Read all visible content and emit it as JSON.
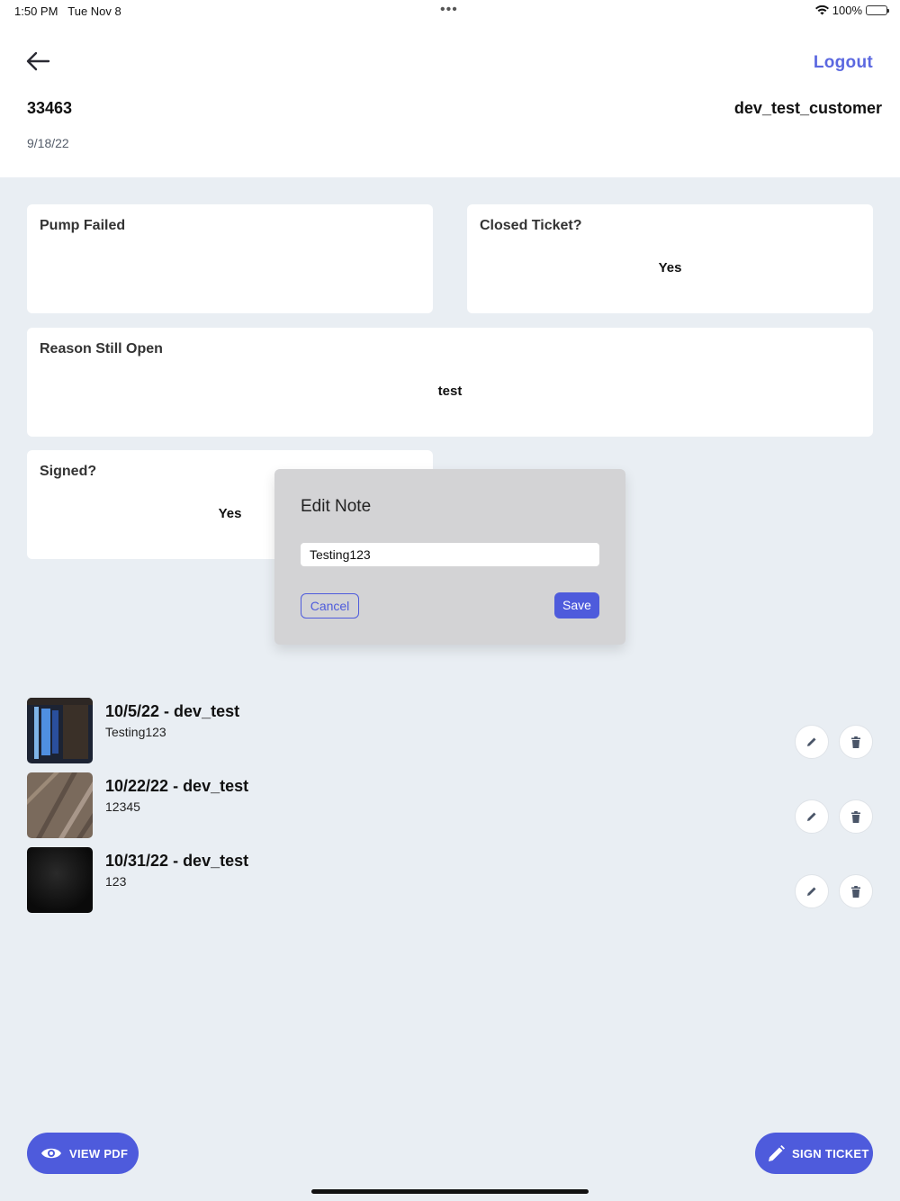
{
  "status_bar": {
    "time": "1:50 PM",
    "date": "Tue Nov 8",
    "battery": "100%"
  },
  "header": {
    "logout_label": "Logout",
    "ticket_id": "33463",
    "customer": "dev_test_customer",
    "date": "9/18/22"
  },
  "cards": {
    "pump_failed": {
      "label": "Pump Failed",
      "value": ""
    },
    "closed_ticket": {
      "label": "Closed Ticket?",
      "value": "Yes"
    },
    "reason_open": {
      "label": "Reason Still Open",
      "value": "test"
    },
    "signed": {
      "label": "Signed?",
      "value": "Yes"
    }
  },
  "modal": {
    "title": "Edit Note",
    "input_value": "Testing123",
    "cancel_label": "Cancel",
    "save_label": "Save"
  },
  "notes": [
    {
      "title": "10/5/22 - dev_test",
      "text": "Testing123"
    },
    {
      "title": "10/22/22 - dev_test",
      "text": "12345"
    },
    {
      "title": "10/31/22 - dev_test",
      "text": "123"
    }
  ],
  "actions": {
    "view_pdf_label": "VIEW PDF",
    "sign_ticket_label": "SIGN TICKET"
  },
  "colors": {
    "accent": "#4e5bdc",
    "background": "#e9eef3",
    "card": "#ffffff"
  }
}
